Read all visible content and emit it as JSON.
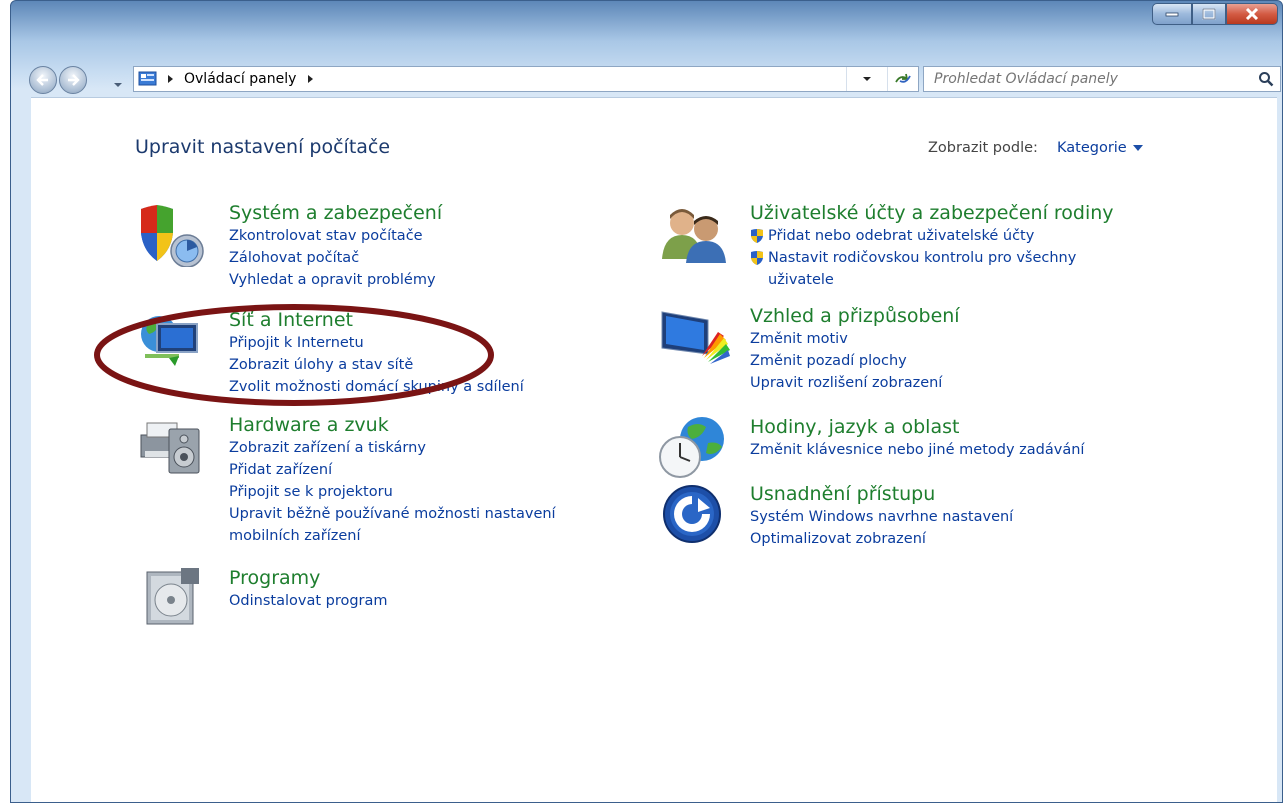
{
  "window": {
    "buttons": {
      "minimize": "minimize-icon",
      "maximize": "maximize-icon",
      "close": "close-icon"
    }
  },
  "navigation": {
    "breadcrumb": [
      "Ovládací panely"
    ],
    "search_placeholder": "Prohledat Ovládací panely"
  },
  "header": {
    "title": "Upravit nastavení počítače",
    "view_by_label": "Zobrazit podle:",
    "view_by_value": "Kategorie"
  },
  "categories": [
    {
      "title": "Systém a zabezpečení",
      "icon": "system-security-icon",
      "links": [
        "Zkontrolovat stav počítače",
        "Zálohovat počítač",
        "Vyhledat a opravit problémy"
      ]
    },
    {
      "title": "Síť a Internet",
      "icon": "network-internet-icon",
      "links": [
        "Připojit k Internetu",
        "Zobrazit úlohy a stav sítě",
        "Zvolit možnosti domácí skupiny a sdílení"
      ]
    },
    {
      "title": "Hardware a zvuk",
      "icon": "hardware-sound-icon",
      "links": [
        "Zobrazit zařízení a tiskárny",
        "Přidat zařízení",
        "Připojit se k projektoru",
        "Upravit běžně používané možnosti nastavení",
        "mobilních zařízení"
      ]
    },
    {
      "title": "Programy",
      "icon": "programs-icon",
      "links": [
        "Odinstalovat program"
      ]
    },
    {
      "title": "Uživatelské účty a zabezpečení rodiny",
      "icon": "user-accounts-icon",
      "links": [
        "Přidat nebo odebrat uživatelské účty",
        "Nastavit rodičovskou kontrolu pro všechny",
        "uživatele"
      ]
    },
    {
      "title": "Vzhled a přizpůsobení",
      "icon": "appearance-icon",
      "links": [
        "Změnit motiv",
        "Změnit pozadí plochy",
        "Upravit rozlišení zobrazení"
      ]
    },
    {
      "title": "Hodiny, jazyk a oblast",
      "icon": "clock-language-icon",
      "links": [
        "Změnit klávesnice nebo jiné metody zadávání"
      ]
    },
    {
      "title": "Usnadnění přístupu",
      "icon": "ease-of-access-icon",
      "links": [
        "Systém Windows navrhne nastavení",
        "Optimalizovat zobrazení"
      ]
    }
  ],
  "annotation": {
    "color": "#7a1414"
  }
}
